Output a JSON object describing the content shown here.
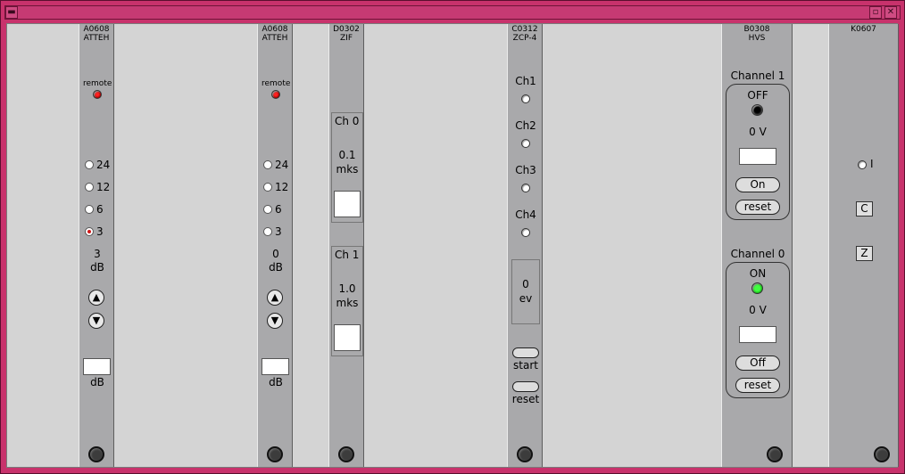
{
  "window": {
    "minimize_icon": "minimize-icon",
    "maximize_icon": "maximize-icon",
    "close_icon": "close-icon"
  },
  "modules": {
    "atten1": {
      "code": "A0608",
      "name": "ATTEH",
      "remote": "remote",
      "opts": [
        "24",
        "12",
        "6",
        "3"
      ],
      "value": "3",
      "unit": "dB",
      "input_unit": "dB"
    },
    "atten2": {
      "code": "A0608",
      "name": "ATTEH",
      "remote": "remote",
      "opts": [
        "24",
        "12",
        "6",
        "3"
      ],
      "value": "0",
      "unit": "dB",
      "input_unit": "dB"
    },
    "zif": {
      "code": "D0302",
      "name": "ZIF",
      "ch0": {
        "label": "Ch 0",
        "value": "0.1",
        "unit": "mks"
      },
      "ch1": {
        "label": "Ch 1",
        "value": "1.0",
        "unit": "mks"
      }
    },
    "zcp": {
      "code": "C0312",
      "name": "ZCP-4",
      "channels": [
        "Ch1",
        "Ch2",
        "Ch3",
        "Ch4"
      ],
      "count": "0",
      "count_unit": "ev",
      "start": "start",
      "reset": "reset"
    },
    "hvs": {
      "code": "B0308",
      "name": "HVS",
      "ch1": {
        "title": "Channel 1",
        "state": "OFF",
        "voltage": "0 V",
        "btn": "On",
        "reset": "reset"
      },
      "ch0": {
        "title": "Channel 0",
        "state": "ON",
        "voltage": "0 V",
        "btn": "Off",
        "reset": "reset"
      }
    },
    "k0607": {
      "code": "K0607",
      "i_label": "I",
      "c_btn": "C",
      "z_btn": "Z"
    }
  }
}
